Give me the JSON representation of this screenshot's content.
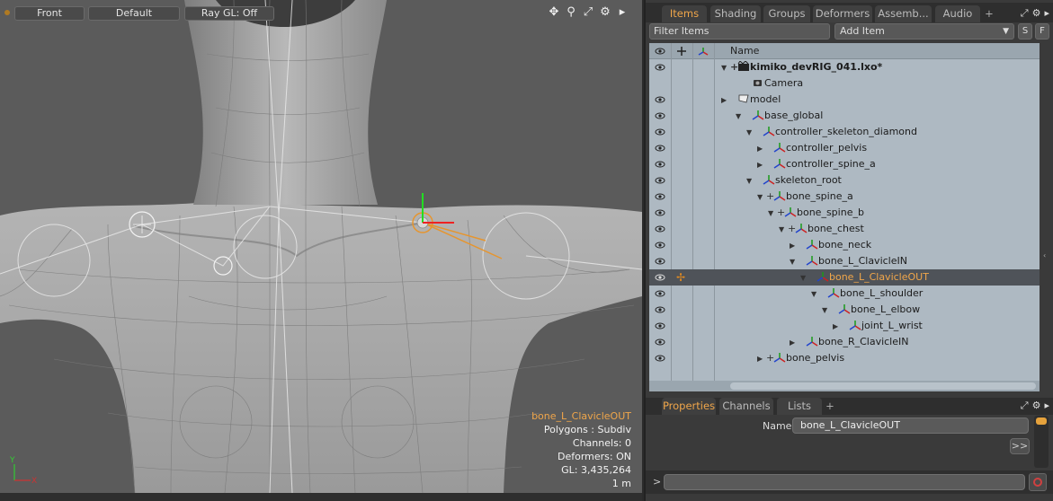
{
  "viewport": {
    "view_label": "Front",
    "style_label": "Default",
    "raygl_label": "Ray GL: Off",
    "tools": [
      "move-view-icon",
      "zoom-view-icon",
      "maximize-icon",
      "gear-icon",
      "arrow-right-icon"
    ],
    "info": {
      "selected": "bone_L_ClavicleOUT",
      "polygons": "Polygons : Subdiv",
      "channels": "Channels: 0",
      "deformers": "Deformers: ON",
      "gl": "GL: 3,435,264",
      "scale": "1 m"
    },
    "axis": {
      "y": "Y",
      "x": "X"
    }
  },
  "items_panel": {
    "tabs": [
      "Items",
      "Shading",
      "Groups",
      "Deformers",
      "Assemb...",
      "Audio"
    ],
    "active_tab": "Items",
    "add_tab": "+",
    "filter_placeholder": "Filter Items",
    "add_item_label": "Add Item",
    "s_button": "S",
    "f_button": "F",
    "column_name": "Name",
    "rows": [
      {
        "label": "kimiko_devRIG_041.lxo*",
        "bold": true,
        "eye": true,
        "icon": "scene-icon",
        "tri": "▼",
        "plus": "+"
      },
      {
        "label": "Camera",
        "eye": false,
        "icon": "camera-icon",
        "tri": "",
        "plus": ""
      },
      {
        "label": "model",
        "eye": true,
        "icon": "mesh-icon",
        "tri": "▶",
        "plus": ""
      },
      {
        "label": "base_global",
        "eye": true,
        "icon": "locator-icon",
        "tri": "▼",
        "plus": ""
      },
      {
        "label": "controller_skeleton_diamond",
        "eye": true,
        "icon": "locator-icon",
        "tri": "▼",
        "plus": ""
      },
      {
        "label": "controller_pelvis",
        "eye": true,
        "icon": "locator-icon",
        "tri": "▶",
        "plus": ""
      },
      {
        "label": "controller_spine_a",
        "eye": true,
        "icon": "locator-icon",
        "tri": "▶",
        "plus": ""
      },
      {
        "label": "skeleton_root",
        "eye": true,
        "icon": "locator-icon",
        "tri": "▼",
        "plus": ""
      },
      {
        "label": "bone_spine_a",
        "eye": true,
        "icon": "locator-icon",
        "tri": "▼",
        "plus": "+"
      },
      {
        "label": "bone_spine_b",
        "eye": true,
        "icon": "locator-icon",
        "tri": "▼",
        "plus": "+"
      },
      {
        "label": "bone_chest",
        "eye": true,
        "icon": "locator-icon",
        "tri": "▼",
        "plus": "+"
      },
      {
        "label": "bone_neck",
        "eye": true,
        "icon": "locator-icon",
        "tri": "▶",
        "plus": ""
      },
      {
        "label": "bone_L_ClavicleIN",
        "eye": true,
        "icon": "locator-icon",
        "tri": "▼",
        "plus": ""
      },
      {
        "label": "bone_L_ClavicleOUT",
        "eye": true,
        "icon": "locator-icon",
        "tri": "▼",
        "plus": "",
        "selected": true
      },
      {
        "label": "bone_L_shoulder",
        "eye": true,
        "icon": "locator-icon",
        "tri": "▼",
        "plus": ""
      },
      {
        "label": "bone_L_elbow",
        "eye": true,
        "icon": "locator-icon",
        "tri": "▼",
        "plus": ""
      },
      {
        "label": "joint_L_wrist",
        "eye": true,
        "icon": "locator-icon",
        "tri": "▶",
        "plus": ""
      },
      {
        "label": "bone_R_ClavicleIN",
        "eye": true,
        "icon": "locator-icon",
        "tri": "▶",
        "plus": ""
      },
      {
        "label": "bone_pelvis",
        "eye": true,
        "icon": "locator-icon",
        "tri": "▶",
        "plus": "+"
      }
    ]
  },
  "properties_panel": {
    "tabs": [
      "Properties",
      "Channels",
      "Lists"
    ],
    "active_tab": "Properties",
    "add_tab": "+",
    "name_label": "Name",
    "name_value": "bone_L_ClavicleOUT",
    "more_button": ">>"
  },
  "command_bar": {
    "prompt": ">"
  },
  "colors": {
    "accent": "#f0a64a",
    "tree_bg": "#aeb9c2",
    "selected_row": "#4f5359"
  }
}
